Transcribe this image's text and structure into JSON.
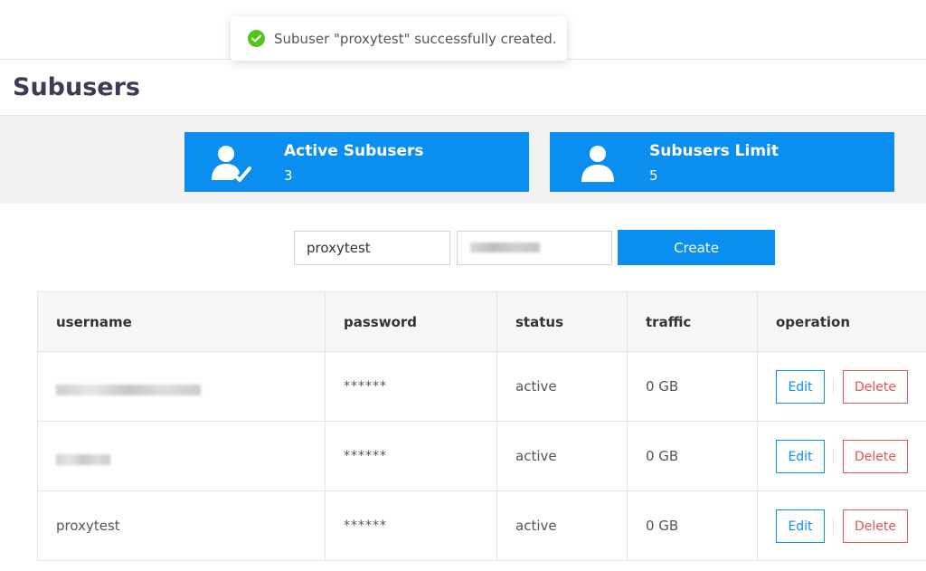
{
  "toast": {
    "message": "Subuser \"proxytest\" successfully created.",
    "icon": "check-circle-icon",
    "color": "#52c41a"
  },
  "page": {
    "title": "Subusers"
  },
  "stats": [
    {
      "label": "Active Subusers",
      "value": "3",
      "icon": "user-check-icon"
    },
    {
      "label": "Subusers Limit",
      "value": "5",
      "icon": "user-icon"
    }
  ],
  "form": {
    "username_value": "proxytest",
    "password_value": "",
    "create_label": "Create"
  },
  "table": {
    "headers": [
      "username",
      "password",
      "status",
      "traffic",
      "operation"
    ],
    "rows": [
      {
        "username": "",
        "password": "******",
        "status": "active",
        "traffic": "0 GB",
        "edit": "Edit",
        "delete": "Delete"
      },
      {
        "username": "",
        "password": "******",
        "status": "active",
        "traffic": "0 GB",
        "edit": "Edit",
        "delete": "Delete"
      },
      {
        "username": "proxytest",
        "password": "******",
        "status": "active",
        "traffic": "0 GB",
        "edit": "Edit",
        "delete": "Delete"
      }
    ]
  },
  "colors": {
    "primary": "#0a8ef0",
    "danger": "#e05555",
    "title": "#3f3a56"
  }
}
